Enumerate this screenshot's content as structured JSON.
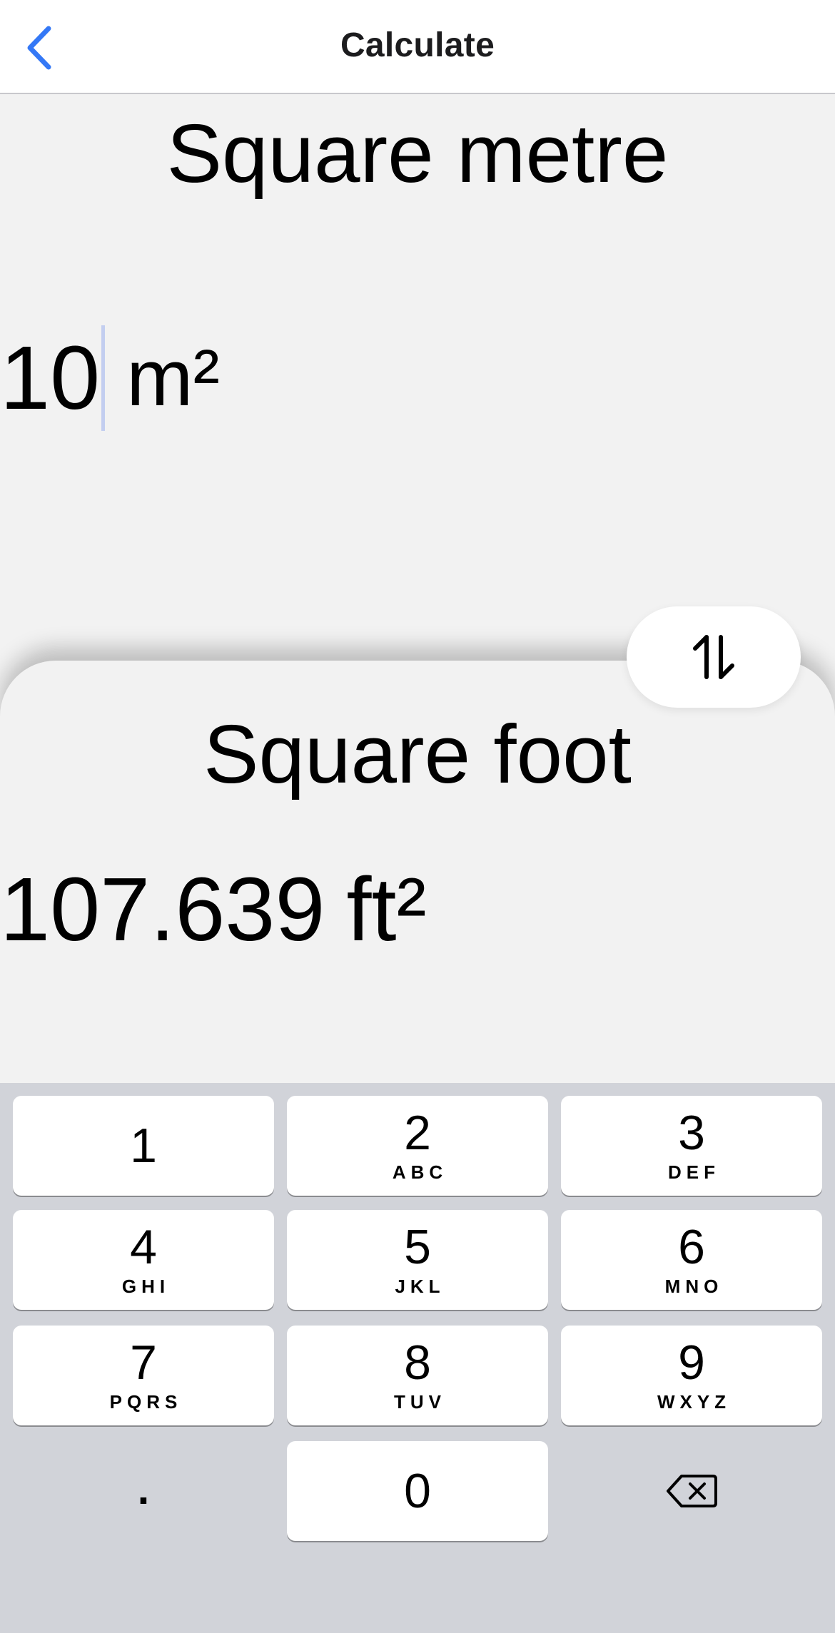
{
  "nav": {
    "title": "Calculate",
    "back_icon": "chevron-left-icon",
    "accent_color": "#3478f6"
  },
  "source": {
    "unit_name": "Square metre",
    "value": "10",
    "unit_symbol": "m²"
  },
  "swap": {
    "icon": "swap-vertical-arrows-icon"
  },
  "target": {
    "unit_name": "Square foot",
    "value": "107.639",
    "unit_symbol": "ft²"
  },
  "keypad": {
    "keys": [
      {
        "digit": "1",
        "letters": ""
      },
      {
        "digit": "2",
        "letters": "ABC"
      },
      {
        "digit": "3",
        "letters": "DEF"
      },
      {
        "digit": "4",
        "letters": "GHI"
      },
      {
        "digit": "5",
        "letters": "JKL"
      },
      {
        "digit": "6",
        "letters": "MNO"
      },
      {
        "digit": "7",
        "letters": "PQRS"
      },
      {
        "digit": "8",
        "letters": "TUV"
      },
      {
        "digit": "9",
        "letters": "WXYZ"
      }
    ],
    "decimal": ".",
    "zero": "0",
    "delete_icon": "backspace-icon"
  }
}
